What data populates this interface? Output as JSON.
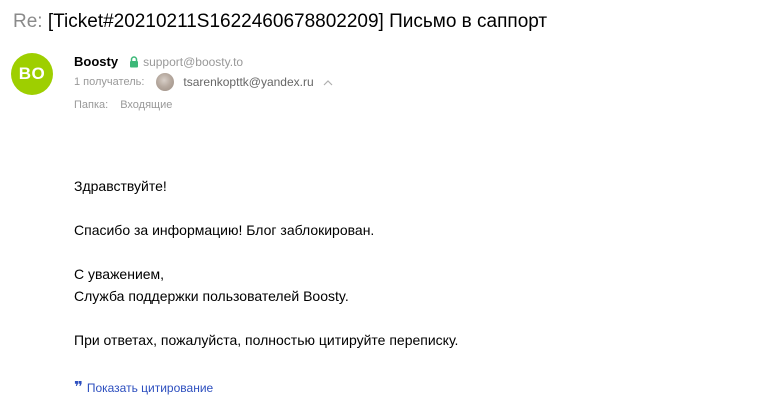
{
  "subject": {
    "prefix": "Re:",
    "title": "[Ticket#20210211S1622460678802209] Письмо в саппорт"
  },
  "sender": {
    "avatar_initials": "BO",
    "avatar_color": "#9ecf00",
    "name": "Boosty",
    "email": "support@boosty.to",
    "verified_color": "#3cb878"
  },
  "recipients": {
    "label": "1 получатель:",
    "email": "tsarenkopttk@yandex.ru"
  },
  "folder": {
    "label": "Папка:",
    "value": "Входящие"
  },
  "message": {
    "greeting": "Здравствуйте!",
    "line1": "Спасибо за информацию! Блог заблокирован.",
    "closing1": "С уважением,",
    "closing2": "Служба поддержки пользователей Boosty.",
    "note": "При ответах, пожалуйста, полностью цитируйте переписку."
  },
  "quote_toggle": {
    "icon": "quote-icon",
    "label": "Показать цитирование",
    "color": "#2d4fbf"
  }
}
